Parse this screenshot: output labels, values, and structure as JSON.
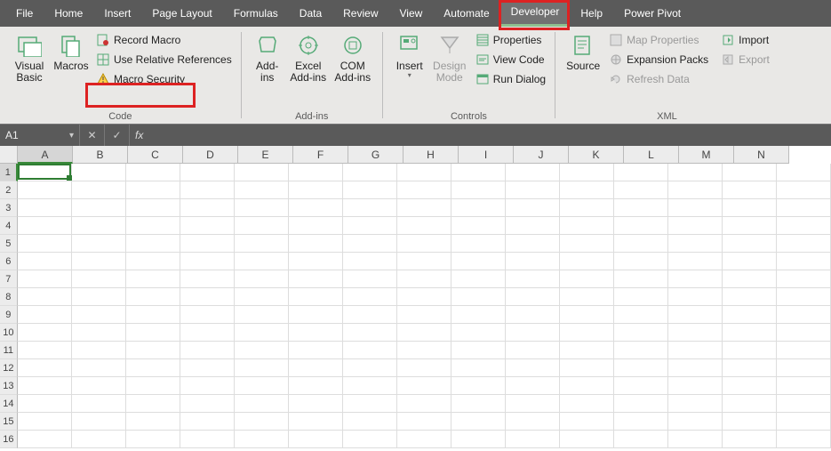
{
  "tabs": [
    "File",
    "Home",
    "Insert",
    "Page Layout",
    "Formulas",
    "Data",
    "Review",
    "View",
    "Automate",
    "Developer",
    "Help",
    "Power Pivot"
  ],
  "active_tab_index": 9,
  "ribbon": {
    "code": {
      "label": "Code",
      "visual_basic": "Visual\nBasic",
      "macros": "Macros",
      "record_macro": "Record Macro",
      "use_relative": "Use Relative References",
      "macro_security": "Macro Security"
    },
    "addins": {
      "label": "Add-ins",
      "addins": "Add-\nins",
      "excel_addins": "Excel\nAdd-ins",
      "com_addins": "COM\nAdd-ins"
    },
    "controls": {
      "label": "Controls",
      "insert": "Insert",
      "design_mode": "Design\nMode",
      "properties": "Properties",
      "view_code": "View Code",
      "run_dialog": "Run Dialog"
    },
    "xml": {
      "label": "XML",
      "source": "Source",
      "map_properties": "Map Properties",
      "expansion_packs": "Expansion Packs",
      "refresh_data": "Refresh Data",
      "import": "Import",
      "export": "Export"
    }
  },
  "formula_bar": {
    "name_box": "A1",
    "fx": "fx"
  },
  "columns": [
    "A",
    "B",
    "C",
    "D",
    "E",
    "F",
    "G",
    "H",
    "I",
    "J",
    "K",
    "L",
    "M",
    "N"
  ],
  "selected_cell": "A1"
}
